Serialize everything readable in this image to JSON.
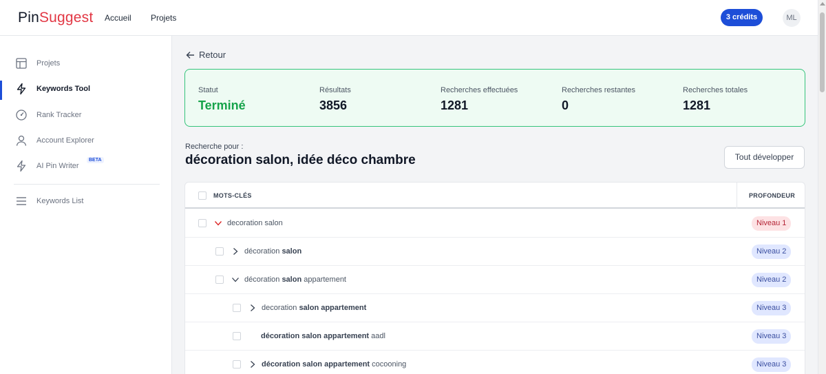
{
  "app": {
    "logo_prefix": "Pin",
    "logo_suffix": "Suggest",
    "accent": "#e23744"
  },
  "topnav": {
    "home": "Accueil",
    "projects": "Projets",
    "credits": "3 crédits",
    "avatar": "ML"
  },
  "sidebar": {
    "items": [
      {
        "label": "Projets",
        "icon": "layout-icon"
      },
      {
        "label": "Keywords Tool",
        "icon": "bolt-icon"
      },
      {
        "label": "Rank Tracker",
        "icon": "gauge-icon"
      },
      {
        "label": "Account Explorer",
        "icon": "user-icon"
      },
      {
        "label": "AI Pin Writer",
        "icon": "bolt-icon",
        "badge": "BETA"
      },
      {
        "label": "Keywords List",
        "icon": "menu-icon"
      }
    ],
    "active": "Keywords Tool"
  },
  "back_label": "Retour",
  "stats": {
    "status_label": "Statut",
    "status_value": "Terminé",
    "results_label": "Résultats",
    "results_value": "3856",
    "done_label": "Recherches effectuées",
    "done_value": "1281",
    "remaining_label": "Recherches restantes",
    "remaining_value": "0",
    "total_label": "Recherches totales",
    "total_value": "1281"
  },
  "search": {
    "label": "Recherche pour :",
    "query": "décoration salon, idée déco chambre",
    "expand_button": "Tout développer"
  },
  "table": {
    "col_keywords": "MOTS-CLÉS",
    "col_depth": "PROFONDEUR",
    "rows": [
      {
        "pre": "decoration salon",
        "bold": "",
        "post": "",
        "depth": "Niveau 1",
        "chevron": "down"
      },
      {
        "pre": "décoration ",
        "bold": "salon",
        "post": "",
        "depth": "Niveau 2",
        "chevron": "right"
      },
      {
        "pre": "décoration ",
        "bold": "salon",
        "post": " appartement",
        "depth": "Niveau 2",
        "chevron": "down"
      },
      {
        "pre": "decoration ",
        "bold": "salon appartement",
        "post": "",
        "depth": "Niveau 3",
        "chevron": "right"
      },
      {
        "pre": "",
        "bold": "décoration salon appartement",
        "post": " aadl",
        "depth": "Niveau 3",
        "chevron": "none"
      },
      {
        "pre": "",
        "bold": "décoration salon appartement",
        "post": " cocooning",
        "depth": "Niveau 3",
        "chevron": "right"
      }
    ]
  }
}
